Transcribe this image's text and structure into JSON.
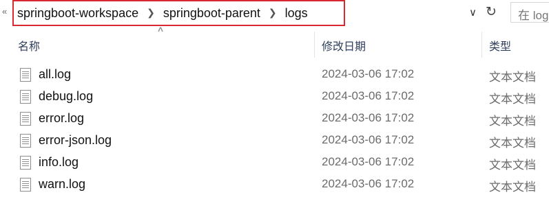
{
  "address_bar": {
    "back_glyph": "«",
    "breadcrumbs": [
      "springboot-workspace",
      "springboot-parent",
      "logs"
    ],
    "search_placeholder": "在 log"
  },
  "columns": {
    "name": "名称",
    "date": "修改日期",
    "type": "类型"
  },
  "files": [
    {
      "name": "all.log",
      "date": "2024-03-06 17:02",
      "type": "文本文档"
    },
    {
      "name": "debug.log",
      "date": "2024-03-06 17:02",
      "type": "文本文档"
    },
    {
      "name": "error.log",
      "date": "2024-03-06 17:02",
      "type": "文本文档"
    },
    {
      "name": "error-json.log",
      "date": "2024-03-06 17:02",
      "type": "文本文档"
    },
    {
      "name": "info.log",
      "date": "2024-03-06 17:02",
      "type": "文本文档"
    },
    {
      "name": "warn.log",
      "date": "2024-03-06 17:02",
      "type": "文本文档"
    }
  ],
  "colors": {
    "highlight_border": "#d9282f",
    "header_text": "#2f3e5a"
  },
  "icons": [
    "chevron-double-left-icon",
    "chevron-right-icon",
    "chevron-down-icon",
    "refresh-icon",
    "text-file-icon",
    "sort-ascending-icon"
  ]
}
